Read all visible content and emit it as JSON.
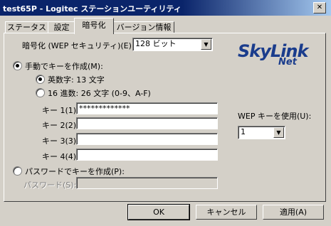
{
  "window": {
    "title": "test65P - Logitec ステーションユーティリティ",
    "close_glyph": "✕"
  },
  "tabs": [
    {
      "label": "ステータス"
    },
    {
      "label": "設定"
    },
    {
      "label": "暗号化"
    },
    {
      "label": "バージョン情報"
    }
  ],
  "encryption": {
    "label": "暗号化 (WEP セキュリティ)(E):",
    "value": "128 ビット"
  },
  "logo": {
    "line1": "SkyLink",
    "line2": "Net"
  },
  "manual": {
    "label": "手動でキーを作成(M):",
    "alpha_label": "英数字: 13 文字",
    "hex_label": "16 進数: 26 文字 (0-9、A-F)"
  },
  "keys": [
    {
      "label": "キー 1(1):",
      "value": "*************"
    },
    {
      "label": "キー 2(2):",
      "value": ""
    },
    {
      "label": "キー 3(3):",
      "value": ""
    },
    {
      "label": "キー 4(4):",
      "value": ""
    }
  ],
  "wep_use": {
    "label": "WEP キーを使用(U):",
    "value": "1"
  },
  "passphrase": {
    "label": "パスワードでキーを作成(P):",
    "field_label": "パスワード(S):",
    "value": ""
  },
  "buttons": {
    "ok": "OK",
    "cancel": "キャンセル",
    "apply": "適用(A)"
  },
  "colors": {
    "title_bar": "#0a246a",
    "face": "#d4d0c8",
    "logo_blue": "#1a3c8c"
  }
}
